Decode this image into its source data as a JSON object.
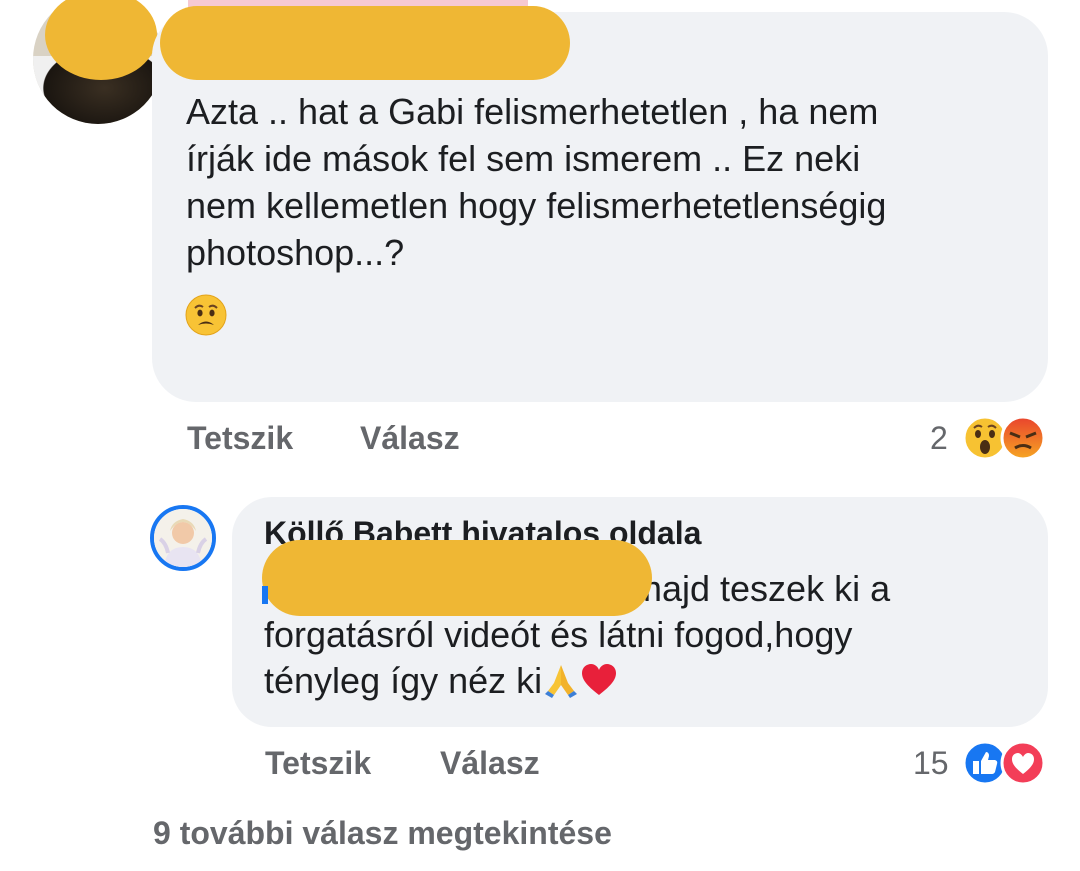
{
  "comment": {
    "text_lines": [
      "Azta .. hat a Gabi felismerhetetlen , ha nem",
      "írják ide mások fel sem ismerem .. Ez neki",
      "nem kellemetlen hogy felismerhetetlenségig",
      "photoshop...?"
    ],
    "emoji": "worried-face-icon",
    "like_label": "Tetszik",
    "reply_label": "Válasz",
    "reaction_count": "2",
    "reactions": [
      "wow-reaction-icon",
      "angry-reaction-icon"
    ]
  },
  "reply": {
    "author": "Köllő Babett hivatalos oldala",
    "text_lines": [
      "majd teszek ki a",
      "forgatásról videót és látni fogod,hogy",
      "tényleg így néz ki"
    ],
    "emojis": [
      "folded-hands-icon",
      "red-heart-icon"
    ],
    "like_label": "Tetszik",
    "reply_label": "Válasz",
    "reaction_count": "15",
    "reactions": [
      "like-reaction-icon",
      "love-reaction-icon"
    ]
  },
  "more_replies": "9 további válasz megtekintése",
  "colors": {
    "bubble": "#f0f2f5",
    "redaction": "#efb734",
    "secondary_text": "#65676b",
    "link_blue": "#1877f2"
  }
}
